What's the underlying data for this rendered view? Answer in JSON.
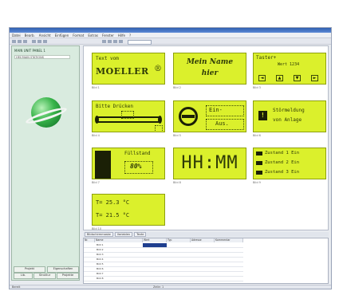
{
  "menubar": {
    "items": [
      "Datei",
      "Bearb.",
      "Ansicht",
      "Einfügen",
      "Format",
      "Extras",
      "Fenster",
      "Hilfe",
      "?"
    ]
  },
  "sidebar": {
    "title": "MAIN UNIT PANEL 1",
    "subtitle": "HMI MAIN STATIONS",
    "tabs": [
      "Projekt",
      "Eigenschaften",
      "Lib.",
      "Struktur",
      "Projekte"
    ]
  },
  "panels": {
    "p1": {
      "line1": "Text vom",
      "brand": "MOELLER",
      "brand_badge": "®",
      "label": "Bild 1"
    },
    "p2": {
      "line1": "Mein Name",
      "line2": "hier",
      "label": "Bild 2"
    },
    "p3": {
      "line1": "Taster+",
      "line2": "Wert 1234",
      "buttons": [
        "◄",
        "▲",
        "▼",
        "►"
      ],
      "label": "Bild 3"
    },
    "p4": {
      "line1": "Bitte Drücken",
      "label": "Bild 4"
    },
    "p5": {
      "line1": "Ein-",
      "line2": "Aus.",
      "label": "Bild 5"
    },
    "p6": {
      "line1": "Störmeldung",
      "line2": "von Anlage",
      "warn": "!",
      "label": "Bild 6"
    },
    "p7": {
      "line1": "Füllstand",
      "value": "80%",
      "label": "Bild 7"
    },
    "p8": {
      "clock": "HH:MM",
      "label": "Bild 8"
    },
    "p9": {
      "rows": [
        "Zustand 1 Ein",
        "Zustand 2 Ein",
        "Zustand 3 Ein"
      ],
      "label": "Bild 9"
    },
    "p10": {
      "line1": "T= 25.3 °C",
      "line2": "T= 21.5 °C",
      "label": "Bild 10"
    }
  },
  "tabs": [
    "Bildschirmmaske",
    "Variablen",
    "Texte"
  ],
  "grid": {
    "headers": [
      "Nr.",
      "Name",
      "Wert",
      "Typ",
      "Adresse",
      "Kommentar"
    ],
    "rows": [
      "Bild 1",
      "Bild 2",
      "Bild 3",
      "Bild 4",
      "Bild 5",
      "Bild 6",
      "Bild 7",
      "Bild 8"
    ]
  },
  "status": {
    "left": "Bereit",
    "right": "Zeile: 1"
  },
  "colors": {
    "lcd": "#dbf02c",
    "sidebar": "#d9ebdf",
    "titlebar": "#2f5fb0"
  }
}
